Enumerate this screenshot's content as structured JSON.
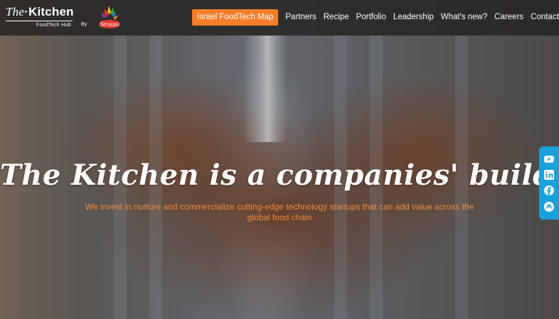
{
  "header": {
    "logo_the": "The",
    "logo_kitchen": "Kitchen",
    "logo_tagline": "FoodTech Hub",
    "by_label": "By",
    "nav": {
      "cta_label": "Israel FoodTech Map",
      "items": [
        "Partners",
        "Recipe",
        "Portfolio",
        "Leadership",
        "What's new?",
        "Careers",
        "Contact"
      ]
    }
  },
  "hero": {
    "headline": "The Kitchen is a companies' builder",
    "subline": "We invest in nurture and commercialize cutting-edge technology startups that can add value across the global food chain"
  },
  "social": {
    "icons": [
      "youtube-icon",
      "linkedin-icon",
      "facebook-icon",
      "jobs-icon"
    ]
  },
  "colors": {
    "accent": "#f47e2a",
    "subline": "#f08a3c",
    "social_rail": "#1aa0db",
    "header_bg": "#282624"
  }
}
